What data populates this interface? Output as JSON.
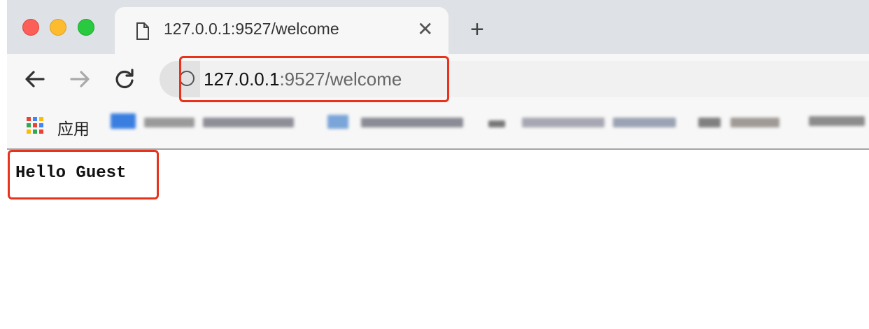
{
  "tab": {
    "title": "127.0.0.1:9527/welcome",
    "close": "✕",
    "new_tab": "+"
  },
  "address_bar": {
    "host": "127.0.0.1",
    "rest": ":9527/welcome"
  },
  "nav": {
    "back_icon": "arrow-left-icon",
    "forward_icon": "arrow-right-icon",
    "reload_icon": "reload-icon"
  },
  "bookmarks": {
    "apps_label": "应用"
  },
  "page": {
    "content_text": "Hello Guest"
  },
  "colors": {
    "highlight": "#e8321c",
    "tabbar_bg": "#dee1e6",
    "toolbar_bg": "#f7f7f7"
  }
}
